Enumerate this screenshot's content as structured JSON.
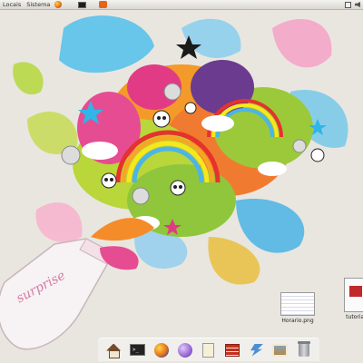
{
  "top_panel": {
    "menus": [
      {
        "label": "Locais"
      },
      {
        "label": "Sistema"
      }
    ],
    "launchers": [
      "firefox-icon",
      "terminal-icon",
      "ubuntu-icon"
    ],
    "indicators": [
      "network-icon",
      "volume-icon"
    ]
  },
  "desktop": {
    "wallpaper": "colorful-splash-bottle-art",
    "icons": [
      {
        "label": "Horario.png",
        "icon": "image-file-icon"
      },
      {
        "label": "tutorial",
        "icon": "document-file-icon"
      }
    ]
  },
  "dock": {
    "items": [
      "home-folder-icon",
      "terminal-icon",
      "firefox-icon",
      "purple-orb-icon",
      "notes-icon",
      "brick-game-icon",
      "bolt-app-icon",
      "photo-viewer-icon",
      "trash-icon"
    ]
  },
  "colors": {
    "panel_bg": "#dad7d0",
    "desktop_bg": "#e9e6e0",
    "orange": "#f0931e",
    "cyan": "#3fb6e8",
    "magenta": "#e0218a",
    "lime": "#b8d432"
  }
}
